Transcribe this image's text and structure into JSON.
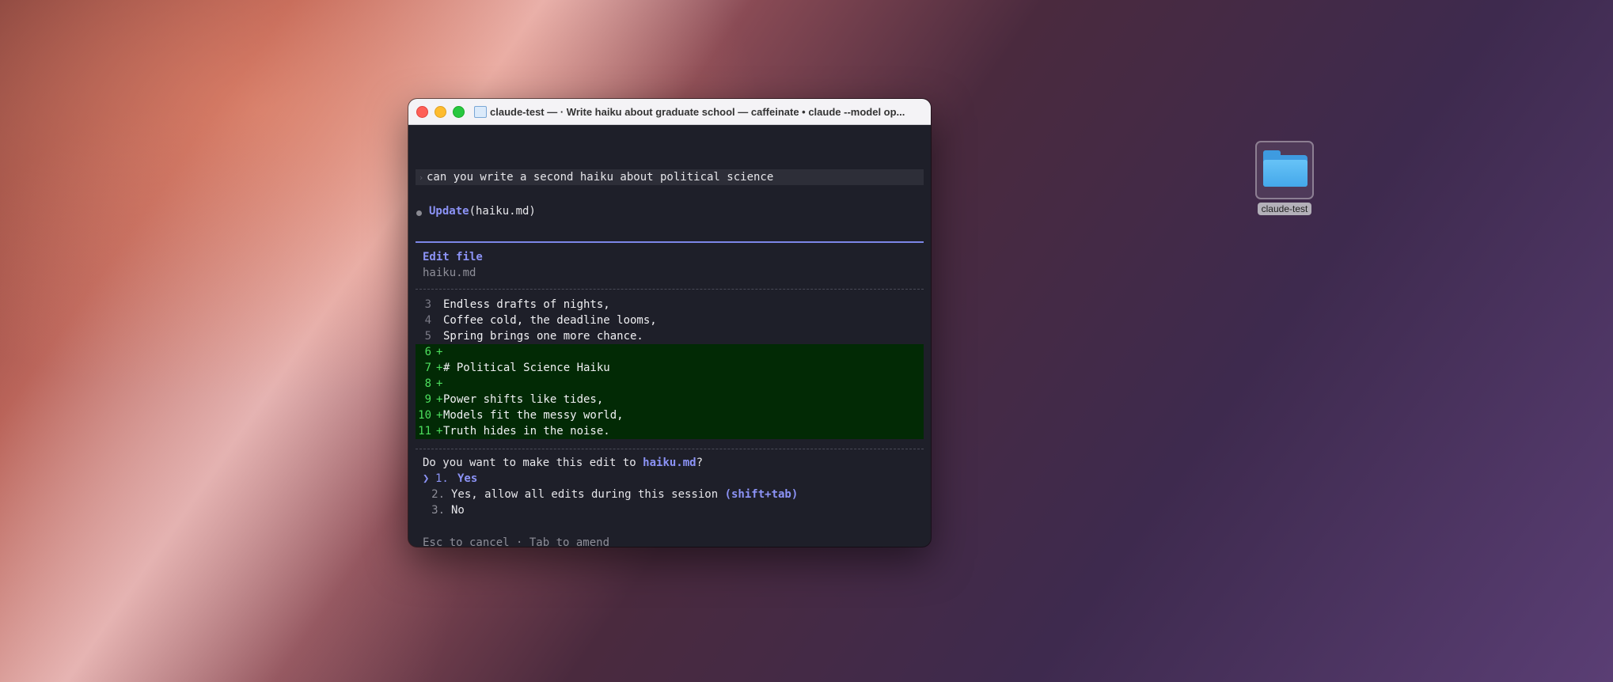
{
  "desktop": {
    "folder_label": "claude-test"
  },
  "window": {
    "title": "claude-test — · Write haiku about graduate school — caffeinate • claude --model op..."
  },
  "conversation": {
    "user_prompt": "can you write a second haiku about political science",
    "tool_name": "Update",
    "tool_args": "(haiku.md)"
  },
  "edit": {
    "title": "Edit file",
    "filename": "haiku.md",
    "lines": [
      {
        "num": "3",
        "text": "Endless drafts of nights,",
        "added": false
      },
      {
        "num": "4",
        "text": "Coffee cold, the deadline looms,",
        "added": false
      },
      {
        "num": "5",
        "text": "Spring brings one more chance.",
        "added": false
      },
      {
        "num": "6",
        "text": "",
        "added": true
      },
      {
        "num": "7",
        "text": "# Political Science Haiku",
        "added": true
      },
      {
        "num": "8",
        "text": "",
        "added": true
      },
      {
        "num": "9",
        "text": "Power shifts like tides,",
        "added": true
      },
      {
        "num": "10",
        "text": "Models fit the messy world,",
        "added": true
      },
      {
        "num": "11",
        "text": "Truth hides in the noise.",
        "added": true
      }
    ]
  },
  "question": {
    "prefix": "Do you want to make this edit to ",
    "file": "haiku.md",
    "suffix": "?",
    "options": [
      {
        "num": "1.",
        "label": "Yes",
        "selected": true
      },
      {
        "num": "2.",
        "label": "Yes, allow all edits during this session ",
        "shortcut": "(shift+tab)"
      },
      {
        "num": "3.",
        "label": "No"
      }
    ],
    "caret": "❯"
  },
  "hint": "Esc to cancel · Tab to amend",
  "colors": {
    "accent": "#8c93f6",
    "added_bg": "#022a05",
    "added_fg": "#4ddf5e",
    "terminal_bg": "#1e1f29"
  }
}
